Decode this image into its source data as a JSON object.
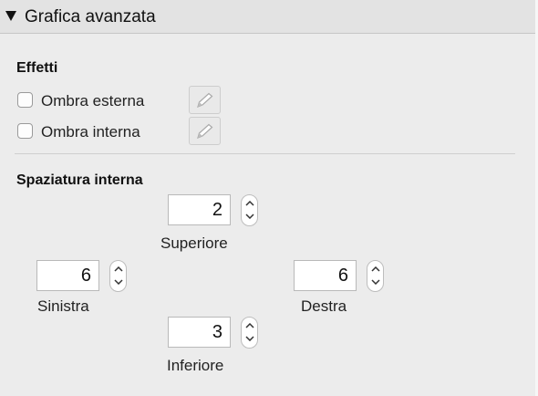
{
  "header": {
    "title": "Grafica avanzata",
    "disclosure_icon": "disclosure-triangle-down-icon"
  },
  "effects": {
    "title": "Effetti",
    "items": [
      {
        "label": "Ombra esterna",
        "checked": false,
        "edit_icon": "pencil-icon"
      },
      {
        "label": "Ombra interna",
        "checked": false,
        "edit_icon": "pencil-icon"
      }
    ]
  },
  "padding": {
    "title": "Spaziatura interna",
    "top": {
      "label": "Superiore",
      "value": "2"
    },
    "left": {
      "label": "Sinistra",
      "value": "6"
    },
    "right": {
      "label": "Destra",
      "value": "6"
    },
    "bottom": {
      "label": "Inferiore",
      "value": "3"
    }
  },
  "colors": {
    "panel_background": "#ececec",
    "header_background": "#e3e3e3",
    "field_background": "#ffffff"
  }
}
